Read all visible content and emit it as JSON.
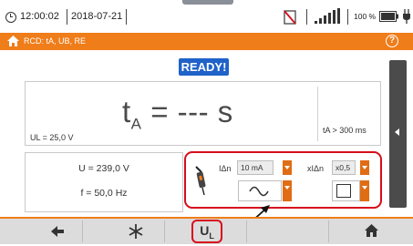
{
  "status_bar": {
    "time": "12:00:02",
    "date": "2018-07-21",
    "battery_percent": "100 %"
  },
  "title_bar": {
    "title": "RCD: tA, UB, RE"
  },
  "ready_label": "READY!",
  "main_result": {
    "t_symbol": "t",
    "t_sub": "A",
    "t_value": "= --- s",
    "ul_label": "UL = 25,0 V",
    "t_limit": "tA > 300 ms"
  },
  "measurements": {
    "voltage": "U = 239,0 V",
    "frequency": "f = 50,0 Hz"
  },
  "settings": {
    "idn_label": "IΔn",
    "idn_value": "10 mA",
    "mult_label": "xIΔn",
    "mult_value": "x0,5"
  },
  "toolbar": {
    "ul_button_label": "U",
    "ul_button_sub": "L"
  },
  "colors": {
    "accent_orange": "#ef7d1a",
    "ready_blue": "#1f62c9",
    "highlight_red": "#d60d1c",
    "panel_dark": "#4b4b4b"
  },
  "icons": [
    "clock-icon",
    "no-signal-icon",
    "signal-bars-icon",
    "battery-icon",
    "plug-icon",
    "home-icon",
    "help-icon",
    "probe-icon",
    "sine-wave-icon",
    "square-wave-icon",
    "back-arrow-icon",
    "settings-star-icon",
    "home-icon"
  ]
}
